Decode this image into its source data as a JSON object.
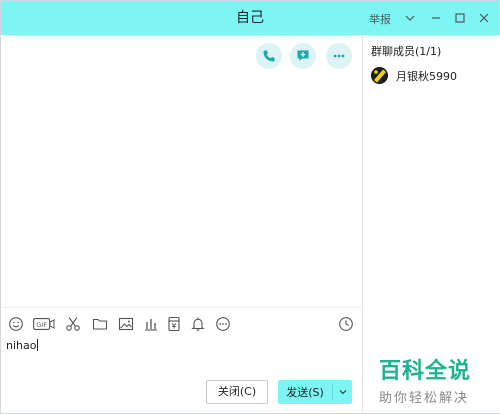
{
  "window": {
    "title": "自己",
    "report_label": "举报"
  },
  "chat": {
    "input_value": "nihao",
    "close_button_label": "关闭(C)",
    "send_button_label": "发送(S)"
  },
  "members": {
    "header": "群聊成员(1/1)",
    "list": [
      {
        "name": "月银秋5990"
      }
    ]
  },
  "watermark": {
    "main": "百科全说",
    "sub": "助你轻松解决"
  },
  "colors": {
    "accent": "#7ef5f5",
    "icon_circle_bg": "#dcf4f6",
    "icon_teal": "#1aa7b0",
    "watermark_green": "#1db38f"
  },
  "icons": {
    "title_bar": [
      "chevron-down-icon",
      "minimize-icon",
      "maximize-icon",
      "close-icon"
    ],
    "chat_top": [
      "phone-icon",
      "add-message-icon",
      "more-icon"
    ],
    "toolbar": [
      "emoji-icon",
      "gif-icon",
      "scissors-icon",
      "folder-icon",
      "image-icon",
      "chart-icon",
      "red-packet-icon",
      "bell-icon",
      "more-icon",
      "clock-icon"
    ]
  }
}
